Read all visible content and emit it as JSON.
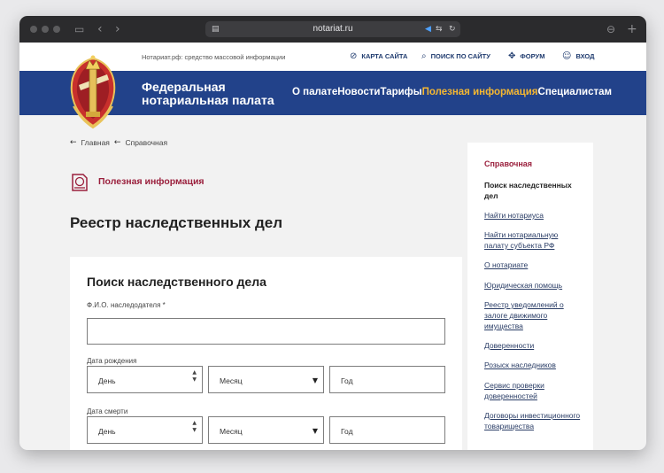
{
  "browser": {
    "url": "notariat.ru",
    "icons": [
      "sidebar-icon",
      "back-icon",
      "forward-icon",
      "reader-icon",
      "lock-icon",
      "speaker-icon",
      "translate-icon",
      "reload-icon",
      "download-icon",
      "new-tab-icon"
    ]
  },
  "topbar": {
    "tagline": "Нотариат.рф: средство массовой информации",
    "sitemap": "КАРТА САЙТА",
    "search": "ПОИСК ПО САЙТУ",
    "forum": "ФОРУМ",
    "login": "ВХОД"
  },
  "header": {
    "brand_line1": "Федеральная",
    "brand_line2": "нотариальная палата",
    "nav": [
      "О палате",
      "Новости",
      "Тарифы",
      "Полезная информация",
      "Специалистам"
    ],
    "active_nav": "Полезная информация"
  },
  "breadcrumb": {
    "items": [
      "Главная",
      "Справочная"
    ]
  },
  "section": {
    "title": "Полезная информация"
  },
  "page": {
    "title": "Реестр наследственных дел"
  },
  "form": {
    "title": "Поиск наследственного дела",
    "name_label": "Ф.И.О. наследодателя *",
    "name_value": "",
    "birth_label": "Дата рождения",
    "death_label": "Дата смерти",
    "day": "День",
    "month": "Месяц",
    "year": "Год"
  },
  "sidebar": {
    "heading": "Справочная",
    "current": "Поиск наследственных дел",
    "links": [
      "Найти нотариуса",
      "Найти нотариальную палату субъекта РФ",
      "О нотариате",
      "Юридическая помощь",
      "Реестр уведомлений о залоге движимого имущества",
      "Доверенности",
      "Розыск наследников",
      "Сервис проверки доверенностей",
      "Договоры инвестиционного товарищества"
    ]
  },
  "colors": {
    "header_bg": "#22428a",
    "accent": "#f5b731",
    "section_red": "#9a1f3c"
  }
}
